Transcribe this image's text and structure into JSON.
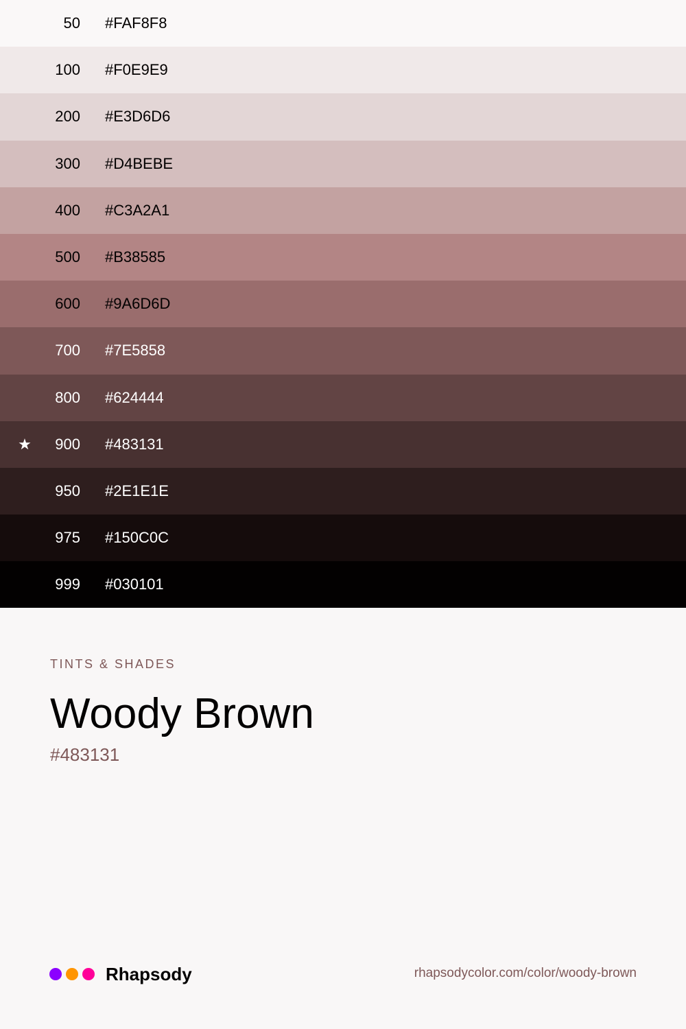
{
  "swatches": [
    {
      "shade": "50",
      "hex": "#FAF8F8",
      "bg": "#FAF8F8",
      "fg": "#030101",
      "star": ""
    },
    {
      "shade": "100",
      "hex": "#F0E9E9",
      "bg": "#F0E9E9",
      "fg": "#030101",
      "star": ""
    },
    {
      "shade": "200",
      "hex": "#E3D6D6",
      "bg": "#E3D6D6",
      "fg": "#030101",
      "star": ""
    },
    {
      "shade": "300",
      "hex": "#D4BEBE",
      "bg": "#D4BEBE",
      "fg": "#030101",
      "star": ""
    },
    {
      "shade": "400",
      "hex": "#C3A2A1",
      "bg": "#C3A2A1",
      "fg": "#030101",
      "star": ""
    },
    {
      "shade": "500",
      "hex": "#B38585",
      "bg": "#B38585",
      "fg": "#030101",
      "star": ""
    },
    {
      "shade": "600",
      "hex": "#9A6D6D",
      "bg": "#9A6D6D",
      "fg": "#030101",
      "star": ""
    },
    {
      "shade": "700",
      "hex": "#7E5858",
      "bg": "#7E5858",
      "fg": "#FFFFFF",
      "star": ""
    },
    {
      "shade": "800",
      "hex": "#624444",
      "bg": "#624444",
      "fg": "#FFFFFF",
      "star": ""
    },
    {
      "shade": "900",
      "hex": "#483131",
      "bg": "#483131",
      "fg": "#FFFFFF",
      "star": "★"
    },
    {
      "shade": "950",
      "hex": "#2E1E1E",
      "bg": "#2E1E1E",
      "fg": "#FFFFFF",
      "star": ""
    },
    {
      "shade": "975",
      "hex": "#150C0C",
      "bg": "#150C0C",
      "fg": "#FFFFFF",
      "star": ""
    },
    {
      "shade": "999",
      "hex": "#030101",
      "bg": "#030101",
      "fg": "#FFFFFF",
      "star": ""
    }
  ],
  "info": {
    "eyebrow": "TINTS & SHADES",
    "name": "Woody Brown",
    "hex": "#483131"
  },
  "footer": {
    "brand": "Rhapsody",
    "dots": [
      "#8B00FF",
      "#FF9500",
      "#FF0099"
    ],
    "url": "rhapsodycolor.com/color/woody-brown"
  }
}
